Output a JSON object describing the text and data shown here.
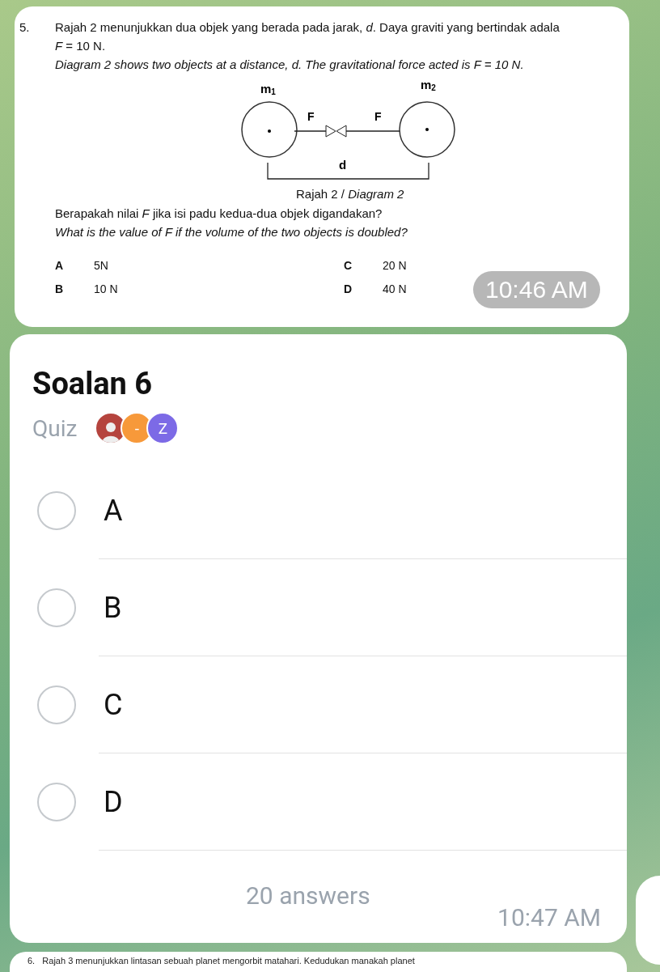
{
  "question_message": {
    "number": "5.",
    "intro_ms": "Rajah 2 menunjukkan dua objek yang berada pada jarak, *d*. Daya graviti yang bertindak adala",
    "intro_ms_value": "*F* = 10 N.",
    "intro_en": "Diagram 2 shows two objects at a distance, d. The gravitational force acted is F = 10 N.",
    "diagram": {
      "mass_1": "m$_{1}$",
      "mass_2": "m$_{2}$",
      "force_left": "F",
      "force_right": "F",
      "distance": "d",
      "caption": "Rajah 2 / *Diagram 2*"
    },
    "question_ms": "Berapakah nilai *F* jika isi padu kedua-dua objek digandakan?",
    "question_en": "What is the value of F if the volume of the two objects is doubled?",
    "options": [
      {
        "letter": "A",
        "value": "5N"
      },
      {
        "letter": "C",
        "value": "20 N"
      },
      {
        "letter": "B",
        "value": "10 N"
      },
      {
        "letter": "D",
        "value": "40 N"
      }
    ],
    "time": "10:46 AM"
  },
  "poll_message": {
    "title": "Soalan 6",
    "type": "Quiz",
    "voters": [
      {
        "kind": "photo"
      },
      {
        "kind": "letter",
        "text": "-",
        "color": "#f7993a"
      },
      {
        "kind": "letter",
        "text": "Z",
        "color": "#7c6ae6"
      }
    ],
    "options": [
      {
        "label": "A",
        "selected": false
      },
      {
        "label": "B",
        "selected": false
      },
      {
        "label": "C",
        "selected": false
      },
      {
        "label": "D",
        "selected": false
      }
    ],
    "answers": "20 answers",
    "time": "10:47 AM"
  },
  "next_message": {
    "text": "6.   Rajah 3 menunjukkan lintasan sebuah planet mengorbit matahari. Kedudukan manakah planet"
  }
}
